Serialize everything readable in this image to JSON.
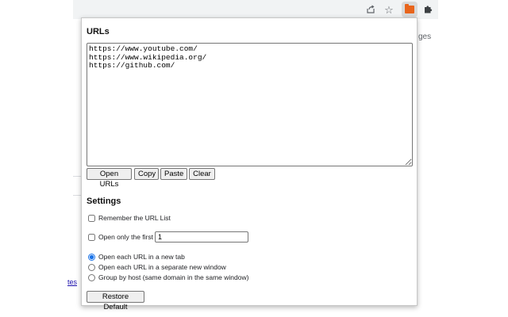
{
  "browser": {
    "toolbar_icons": [
      "share-icon",
      "star-icon",
      "extension-folder-icon",
      "puzzle-icon"
    ],
    "accent_color": "#e8641b"
  },
  "background_page": {
    "right_fragment": "ges",
    "left_fragment": "tes"
  },
  "popup": {
    "urls_title": "URLs",
    "urls_value": "https://www.youtube.com/\nhttps://www.wikipedia.org/\nhttps://github.com/",
    "buttons": {
      "open_urls": "Open URLs",
      "copy": "Copy",
      "paste": "Paste",
      "clear": "Clear",
      "restore_default": "Restore Default"
    },
    "settings_title": "Settings",
    "remember_label": "Remember the URL List",
    "remember_checked": false,
    "open_first_label": "Open only the first",
    "open_first_checked": false,
    "open_first_value": "1",
    "radio_options": [
      {
        "label": "Open each URL in a new tab",
        "checked": true
      },
      {
        "label": "Open each URL in a separate new window",
        "checked": false
      },
      {
        "label": "Group by host (same domain in the same window)",
        "checked": false
      }
    ],
    "radio_accent": "#1a73e8"
  }
}
